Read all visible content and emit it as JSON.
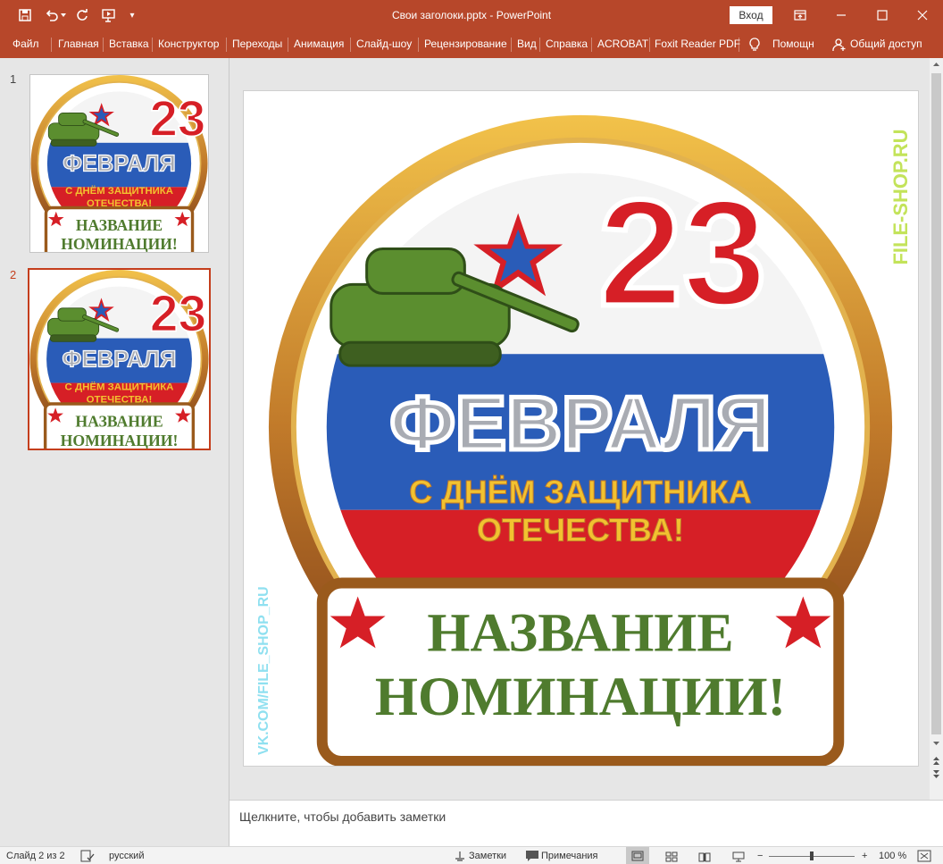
{
  "window": {
    "title": "Свои заголоки.pptx  -  PowerPoint",
    "login": "Вход"
  },
  "qat": {
    "customize": "▾"
  },
  "ribbon": {
    "tabs": [
      "Файл",
      "Главная",
      "Вставка",
      "Конструктор",
      "Переходы",
      "Анимация",
      "Слайд-шоу",
      "Рецензирование",
      "Вид",
      "Справка",
      "ACROBAT",
      "Foxit Reader PDF"
    ],
    "help": "Помощн",
    "share": "Общий доступ"
  },
  "slides": {
    "num1": "1",
    "num2": "2"
  },
  "slide": {
    "number_big": "23",
    "month": "ФЕВРАЛЯ",
    "greeting_1": "С ДНЁМ ЗАЩИТНИКА",
    "greeting_2": "ОТЕЧЕСТВА!",
    "nomination_1": "НАЗВАНИЕ",
    "nomination_2": "НОМИНАЦИИ!",
    "watermark_1": "FILE-SHOP.RU",
    "watermark_2": "VK.COM/FILE_SHOP_RU"
  },
  "notes": {
    "placeholder": "Щелкните, чтобы добавить заметки"
  },
  "status": {
    "slide_info": "Слайд 2 из 2",
    "language": "русский",
    "notes_btn": "Заметки",
    "comments_btn": "Примечания",
    "zoom": "100 %",
    "zoom_level": 0.5
  },
  "colors": {
    "accent": "#b7472a",
    "flag_white": "#f4f4f4",
    "flag_blue": "#2a5cb8",
    "flag_red": "#d61f26",
    "gold": "#c9922c",
    "text_green": "#4f7b2e",
    "star_red": "#d61f26"
  }
}
